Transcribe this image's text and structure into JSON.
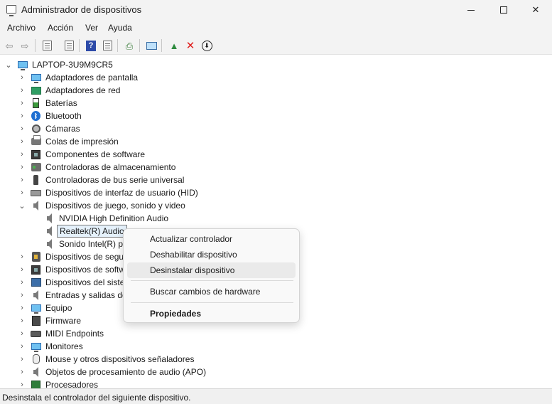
{
  "window": {
    "title": "Administrador de dispositivos",
    "controls": {
      "minimize": "minimize-icon",
      "maximize": "maximize-icon",
      "close": "✕"
    }
  },
  "menu": [
    "Archivo",
    "Acción",
    "Ver",
    "Ayuda"
  ],
  "toolbar": {
    "icons": [
      "back-arrow-icon",
      "forward-arrow-icon",
      "properties-icon",
      "document-icon",
      "help-icon",
      "details-icon",
      "scan-icon",
      "monitor-icon",
      "update-driver-icon",
      "uninstall-icon",
      "download-icon"
    ],
    "uninstall_color": "#e0201f"
  },
  "tree": {
    "root": "LAPTOP-3U9M9CR5",
    "categories": [
      {
        "label": "Adaptadores de pantalla",
        "icon": "display-adapter-icon"
      },
      {
        "label": "Adaptadores de red",
        "icon": "network-adapter-icon"
      },
      {
        "label": "Baterías",
        "icon": "battery-icon"
      },
      {
        "label": "Bluetooth",
        "icon": "bluetooth-icon"
      },
      {
        "label": "Cámaras",
        "icon": "camera-icon"
      },
      {
        "label": "Colas de impresión",
        "icon": "printer-icon"
      },
      {
        "label": "Componentes de software",
        "icon": "software-component-icon"
      },
      {
        "label": "Controladoras de almacenamiento",
        "icon": "storage-controller-icon"
      },
      {
        "label": "Controladoras de bus serie universal",
        "icon": "usb-icon"
      },
      {
        "label": "Dispositivos de interfaz de usuario (HID)",
        "icon": "hid-icon"
      },
      {
        "label": "Dispositivos de juego, sonido y video",
        "icon": "speaker-icon",
        "expanded": true
      },
      {
        "label": "NVIDIA High Definition Audio",
        "icon": "speaker-icon",
        "child": true
      },
      {
        "label": "Realtek(R) Audio",
        "icon": "speaker-icon",
        "child": true,
        "selected": true
      },
      {
        "label": "Sonido Intel(R) pa",
        "icon": "speaker-icon",
        "child": true
      },
      {
        "label": "Dispositivos de segur",
        "icon": "security-device-icon"
      },
      {
        "label": "Dispositivos de softw",
        "icon": "software-device-icon"
      },
      {
        "label": "Dispositivos del siste",
        "icon": "system-device-icon"
      },
      {
        "label": "Entradas y salidas de",
        "icon": "audio-io-icon"
      },
      {
        "label": "Equipo",
        "icon": "computer-icon"
      },
      {
        "label": "Firmware",
        "icon": "firmware-icon"
      },
      {
        "label": "MIDI Endpoints",
        "icon": "midi-icon"
      },
      {
        "label": "Monitores",
        "icon": "monitor-icon"
      },
      {
        "label": "Mouse y otros dispositivos señaladores",
        "icon": "mouse-icon"
      },
      {
        "label": "Objetos de procesamiento de audio (APO)",
        "icon": "speaker-icon"
      },
      {
        "label": "Procesadores",
        "icon": "processor-icon"
      }
    ]
  },
  "context_menu": {
    "items": [
      {
        "label": "Actualizar controlador"
      },
      {
        "label": "Deshabilitar dispositivo"
      },
      {
        "label": "Desinstalar dispositivo",
        "hover": true
      },
      {
        "label": "Buscar cambios de hardware"
      },
      {
        "label": "Propiedades",
        "bold": true
      }
    ]
  },
  "status": "Desinstala el controlador del siguiente dispositivo."
}
